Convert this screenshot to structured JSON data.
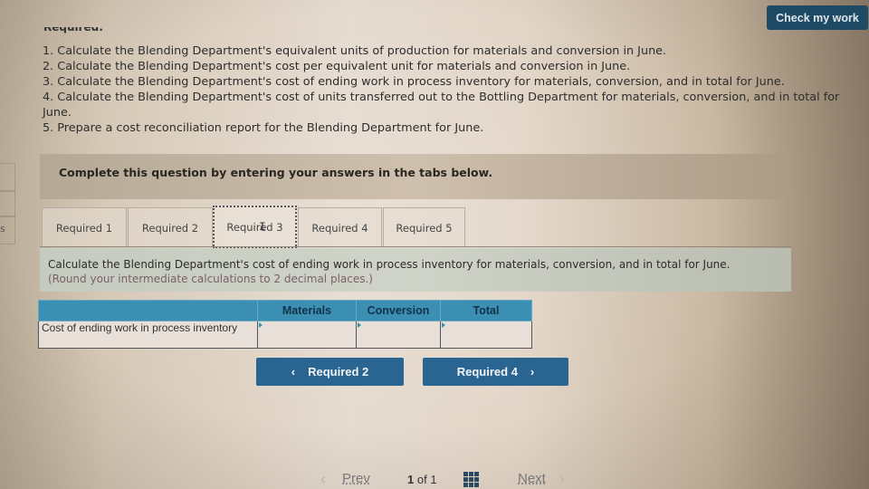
{
  "header": {
    "check_button": "Check my work",
    "required_heading": "Required:"
  },
  "requirements": [
    "1. Calculate the Blending Department's equivalent units of production for materials and conversion in June.",
    "2. Calculate the Blending Department's cost per equivalent unit for materials and conversion in June.",
    "3. Calculate the Blending Department's cost of ending work in process inventory for materials, conversion, and in total for June.",
    "4. Calculate the Blending Department's cost of units transferred out to the Bottling Department for materials, conversion, and in total for June.",
    "5. Prepare a cost reconciliation report for the Blending Department for June."
  ],
  "left_strip_letter": "s",
  "complete_prompt": "Complete this question by entering your answers in the tabs below.",
  "tabs": [
    {
      "label": "Required 1",
      "active": false
    },
    {
      "label": "Required 2",
      "active": false
    },
    {
      "label": "Required 3",
      "active": true
    },
    {
      "label": "Required 4",
      "active": false
    },
    {
      "label": "Required 5",
      "active": false
    }
  ],
  "instructions": {
    "line1": "Calculate the Blending Department's cost of ending work in process inventory for materials, conversion, and in total for June.",
    "line2": "(Round your intermediate calculations to 2 decimal places.)"
  },
  "answer_table": {
    "headers": [
      "",
      "Materials",
      "Conversion",
      "Total"
    ],
    "rows": [
      {
        "label": "Cost of ending work in process inventory",
        "materials": "",
        "conversion": "",
        "total": ""
      }
    ]
  },
  "navigation": {
    "prev_tab": "Required 2",
    "next_tab": "Required 4",
    "prev_chevron": "‹",
    "next_chevron": "›"
  },
  "pager": {
    "prev": "Prev",
    "current": "1",
    "of_label": "of",
    "total": "1",
    "next": "Next",
    "prev_chevron": "‹",
    "next_chevron": "›"
  },
  "colors": {
    "check_button": "#1f4a66",
    "nav_button": "#2a6591",
    "table_header": "#3a8fb3",
    "instruction_note": "#7a5f6a"
  }
}
